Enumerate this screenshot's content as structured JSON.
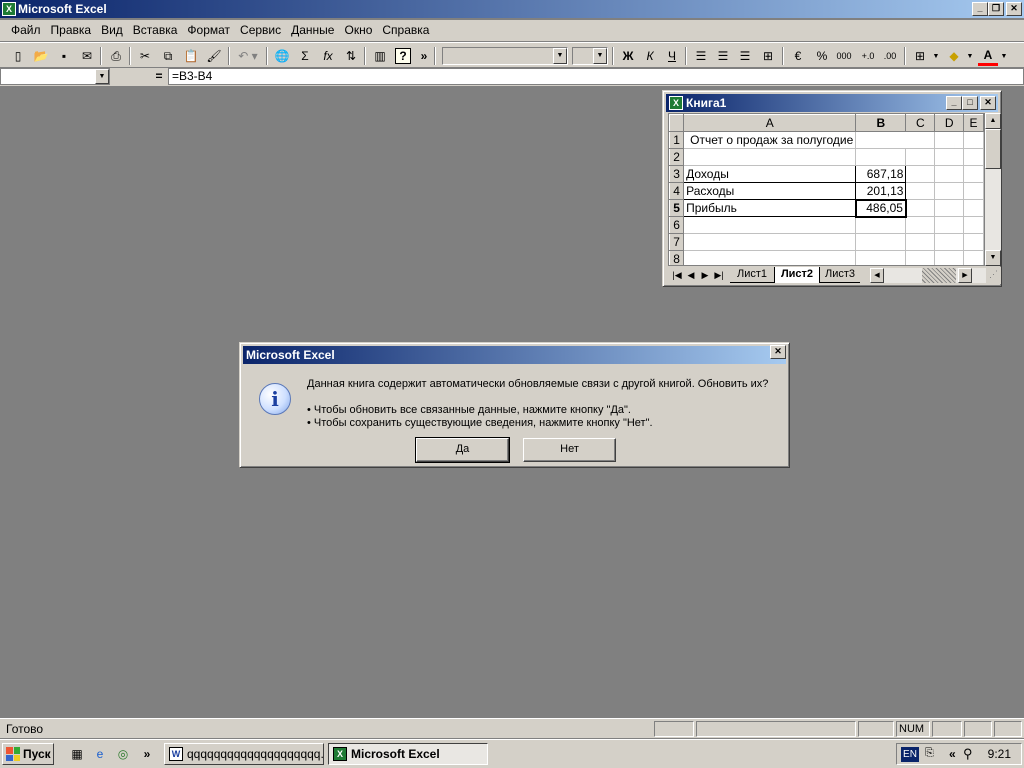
{
  "app": {
    "title": "Microsoft Excel",
    "icon": "excel-icon"
  },
  "menu": [
    "Файл",
    "Правка",
    "Вид",
    "Вставка",
    "Формат",
    "Сервис",
    "Данные",
    "Окно",
    "Справка"
  ],
  "toolbar": {
    "font_buttons": {
      "bold": "Ж",
      "italic": "К",
      "underline": "Ч"
    },
    "percent": "%",
    "thousands": "000",
    "sigma": "Σ",
    "fx": "fx",
    "more": "»"
  },
  "formula_bar": {
    "name_box": "",
    "equals": "=",
    "formula": "=B3-B4"
  },
  "workbook": {
    "title": "Книга1",
    "columns": [
      "A",
      "B",
      "C",
      "D",
      "E"
    ],
    "selected_column": "B",
    "rows": [
      {
        "num": "1",
        "A": "Отчет о продаж за полугодие",
        "B": ""
      },
      {
        "num": "2",
        "A": "",
        "B": ""
      },
      {
        "num": "3",
        "A": "Доходы",
        "B": "687,18"
      },
      {
        "num": "4",
        "A": "Расходы",
        "B": "201,13"
      },
      {
        "num": "5",
        "A": "Прибыль",
        "B": "486,05"
      },
      {
        "num": "6",
        "A": "",
        "B": ""
      },
      {
        "num": "7",
        "A": "",
        "B": ""
      },
      {
        "num": "8",
        "A": "",
        "B": ""
      }
    ],
    "selected_row": "5",
    "sheet_tabs": [
      "Лист1",
      "Лист2",
      "Лист3"
    ],
    "active_sheet": "Лист2"
  },
  "dialog": {
    "title": "Microsoft Excel",
    "message": "Данная книга содержит автоматически обновляемые связи с другой книгой. Обновить их?",
    "bullet1": "• Чтобы обновить все связанные данные, нажмите кнопку \"Да\".",
    "bullet2": "• Чтобы сохранить существующие сведения, нажмите кнопку \"Нет\".",
    "yes_label": "Да",
    "no_label": "Нет",
    "icon": "information-icon"
  },
  "status": {
    "text": "Готово",
    "num": "NUM"
  },
  "taskbar": {
    "start_label": "Пуск",
    "tasks": [
      {
        "label": "qqqqqqqqqqqqqqqqqqqq...",
        "icon": "word-icon"
      },
      {
        "label": "Microsoft Excel",
        "icon": "excel-icon"
      }
    ],
    "language": "EN",
    "clock": "9:21",
    "chevron": "»",
    "tray_chevron": "«"
  }
}
